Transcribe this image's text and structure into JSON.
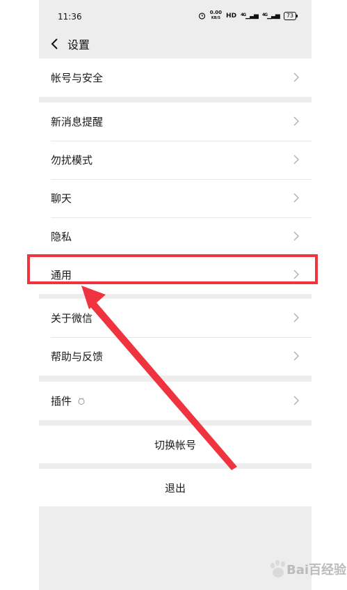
{
  "status_bar": {
    "time": "11:36",
    "net_speed_top": "0.00",
    "net_speed_unit": "KB/S",
    "hd_label": "HD",
    "signal1": "4G",
    "signal2": "4G",
    "battery": "73"
  },
  "navbar": {
    "title": "设置"
  },
  "groups": {
    "account": {
      "items": [
        {
          "label": "帐号与安全"
        }
      ]
    },
    "notifications": {
      "items": [
        {
          "label": "新消息提醒"
        },
        {
          "label": "勿扰模式"
        },
        {
          "label": "聊天"
        },
        {
          "label": "隐私"
        },
        {
          "label": "通用"
        }
      ]
    },
    "about": {
      "items": [
        {
          "label": "关于微信"
        },
        {
          "label": "帮助与反馈"
        }
      ]
    },
    "plugins": {
      "items": [
        {
          "label": "插件"
        }
      ]
    }
  },
  "actions": {
    "switch_account": "切换帐号",
    "logout": "退出"
  },
  "annotation": {
    "highlight_color": "#f0343f",
    "highlight_target": "通用"
  },
  "watermark": {
    "brand": "Bai百经验"
  },
  "colors": {
    "background": "#ededed",
    "card": "#ffffff",
    "accent_red": "#f0343f"
  }
}
